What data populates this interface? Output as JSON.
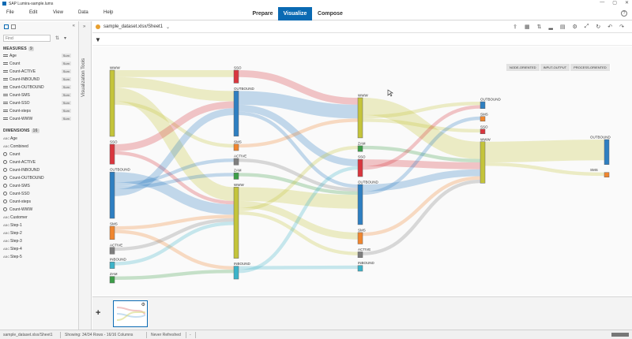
{
  "window": {
    "title": "SAP Lumira-sample.lums",
    "controls": [
      "—",
      "▢",
      "✕"
    ]
  },
  "menubar": {
    "items": [
      "File",
      "Edit",
      "View",
      "Data",
      "Help"
    ],
    "modes": [
      "Prepare",
      "Visualize",
      "Compose"
    ],
    "active_mode": "Visualize"
  },
  "left_panel": {
    "search_placeholder": "Find",
    "measures_label": "MEASURES",
    "measures_count": "9",
    "measures": [
      {
        "name": "Age",
        "agg": "Sum"
      },
      {
        "name": "Count",
        "agg": "Sum"
      },
      {
        "name": "Count-ACTIVE",
        "agg": "Sum"
      },
      {
        "name": "Count-INBOUND",
        "agg": "Sum"
      },
      {
        "name": "Count-OUTBOUND",
        "agg": "Sum"
      },
      {
        "name": "Count-SMS",
        "agg": "Sum"
      },
      {
        "name": "Count-SSO",
        "agg": "Sum"
      },
      {
        "name": "Count-steps",
        "agg": "Sum"
      },
      {
        "name": "Count-WWW",
        "agg": "Sum"
      }
    ],
    "dimensions_label": "DIMENSIONS",
    "dimensions_count": "16",
    "dimensions": [
      {
        "name": "Age",
        "type": "ABC"
      },
      {
        "name": "Combined",
        "type": "ABC"
      },
      {
        "name": "Count",
        "type": "clock"
      },
      {
        "name": "Count-ACTIVE",
        "type": "clock"
      },
      {
        "name": "Count-INBOUND",
        "type": "clock"
      },
      {
        "name": "Count-OUTBOUND",
        "type": "clock"
      },
      {
        "name": "Count-SMS",
        "type": "clock"
      },
      {
        "name": "Count-SSO",
        "type": "clock"
      },
      {
        "name": "Count-steps",
        "type": "clock"
      },
      {
        "name": "Count-WWW",
        "type": "clock"
      },
      {
        "name": "Customer",
        "type": "ABC"
      },
      {
        "name": "Step-1",
        "type": "ABC"
      },
      {
        "name": "Step-2",
        "type": "ABC"
      },
      {
        "name": "Step-3",
        "type": "ABC"
      },
      {
        "name": "Step-4",
        "type": "ABC"
      },
      {
        "name": "Step-5",
        "type": "ABC"
      }
    ]
  },
  "visualization_tools_label": "Visualization Tools",
  "document_tab": {
    "dataset": "sample_dataset.xlsx/Sheet1"
  },
  "view_buttons": [
    "NODE-ORIENTED",
    "INPUT-OUTPUT",
    "PROCESS-ORIENTED"
  ],
  "sankey": {
    "colors": {
      "WWW": "#c4c43a",
      "SSO": "#d9363e",
      "OUTBOUND": "#2e7fc1",
      "SMS": "#f0862e",
      "ACTIVE": "#7f7f7f",
      "INBOUND": "#3cb3c9",
      "ZAM": "#3d9e48"
    },
    "columns": [
      {
        "nodes": [
          {
            "label": "WWW",
            "cat": "WWW"
          },
          {
            "label": "SSO",
            "cat": "SSO"
          },
          {
            "label": "OUTBOUND",
            "cat": "OUTBOUND"
          },
          {
            "label": "SMS",
            "cat": "SMS"
          },
          {
            "label": "ACTIVE",
            "cat": "ACTIVE"
          },
          {
            "label": "INBOUND",
            "cat": "INBOUND"
          },
          {
            "label": "ZAM",
            "cat": "ZAM"
          }
        ]
      },
      {
        "nodes": [
          {
            "label": "SSO",
            "cat": "SSO"
          },
          {
            "label": "OUTBOUND",
            "cat": "OUTBOUND"
          },
          {
            "label": "SMS",
            "cat": "SMS"
          },
          {
            "label": "ACTIVE",
            "cat": "ACTIVE"
          },
          {
            "label": "ZAM",
            "cat": "ZAM"
          },
          {
            "label": "WWW",
            "cat": "WWW"
          },
          {
            "label": "INBOUND",
            "cat": "INBOUND"
          }
        ]
      },
      {
        "nodes": [
          {
            "label": "WWW",
            "cat": "WWW"
          },
          {
            "label": "ZAM",
            "cat": "ZAM"
          },
          {
            "label": "SSO",
            "cat": "SSO"
          },
          {
            "label": "OUTBOUND",
            "cat": "OUTBOUND"
          },
          {
            "label": "SMS",
            "cat": "SMS"
          },
          {
            "label": "ACTIVE",
            "cat": "ACTIVE"
          },
          {
            "label": "INBOUND",
            "cat": "INBOUND"
          }
        ]
      },
      {
        "nodes": [
          {
            "label": "OUTBOUND",
            "cat": "OUTBOUND"
          },
          {
            "label": "SMS",
            "cat": "SMS"
          },
          {
            "label": "SSO",
            "cat": "SSO"
          },
          {
            "label": "WWW",
            "cat": "WWW"
          }
        ]
      },
      {
        "nodes": [
          {
            "label": "OUTBOUND",
            "cat": "OUTBOUND"
          },
          {
            "label": "SMS",
            "cat": "SMS"
          }
        ]
      }
    ],
    "links": [
      {
        "from": [
          0,
          0
        ],
        "to": [
          1,
          0
        ],
        "value": 2
      },
      {
        "from": [
          0,
          0
        ],
        "to": [
          1,
          1
        ],
        "value": 3
      },
      {
        "from": [
          0,
          0
        ],
        "to": [
          1,
          5
        ],
        "value": 4
      },
      {
        "from": [
          0,
          0
        ],
        "to": [
          1,
          2
        ],
        "value": 1
      },
      {
        "from": [
          0,
          1
        ],
        "to": [
          1,
          1
        ],
        "value": 2
      },
      {
        "from": [
          0,
          1
        ],
        "to": [
          1,
          5
        ],
        "value": 1
      },
      {
        "from": [
          0,
          2
        ],
        "to": [
          1,
          5
        ],
        "value": 3
      },
      {
        "from": [
          0,
          2
        ],
        "to": [
          1,
          3
        ],
        "value": 1
      },
      {
        "from": [
          0,
          2
        ],
        "to": [
          1,
          4
        ],
        "value": 1
      },
      {
        "from": [
          0,
          2
        ],
        "to": [
          1,
          1
        ],
        "value": 2
      },
      {
        "from": [
          0,
          3
        ],
        "to": [
          1,
          5
        ],
        "value": 1
      },
      {
        "from": [
          0,
          3
        ],
        "to": [
          1,
          6
        ],
        "value": 1
      },
      {
        "from": [
          0,
          4
        ],
        "to": [
          1,
          5
        ],
        "value": 1
      },
      {
        "from": [
          0,
          5
        ],
        "to": [
          1,
          5
        ],
        "value": 1
      },
      {
        "from": [
          0,
          6
        ],
        "to": [
          1,
          6
        ],
        "value": 1
      },
      {
        "from": [
          1,
          0
        ],
        "to": [
          2,
          0
        ],
        "value": 2
      },
      {
        "from": [
          1,
          1
        ],
        "to": [
          2,
          0
        ],
        "value": 4
      },
      {
        "from": [
          1,
          1
        ],
        "to": [
          2,
          2
        ],
        "value": 2
      },
      {
        "from": [
          1,
          1
        ],
        "to": [
          2,
          3
        ],
        "value": 1
      },
      {
        "from": [
          1,
          2
        ],
        "to": [
          2,
          0
        ],
        "value": 1
      },
      {
        "from": [
          1,
          3
        ],
        "to": [
          2,
          3
        ],
        "value": 1
      },
      {
        "from": [
          1,
          4
        ],
        "to": [
          2,
          3
        ],
        "value": 1
      },
      {
        "from": [
          1,
          5
        ],
        "to": [
          2,
          3
        ],
        "value": 4
      },
      {
        "from": [
          1,
          5
        ],
        "to": [
          2,
          4
        ],
        "value": 2
      },
      {
        "from": [
          1,
          5
        ],
        "to": [
          2,
          1
        ],
        "value": 1
      },
      {
        "from": [
          1,
          5
        ],
        "to": [
          2,
          5
        ],
        "value": 1
      },
      {
        "from": [
          1,
          6
        ],
        "to": [
          2,
          6
        ],
        "value": 1
      },
      {
        "from": [
          1,
          6
        ],
        "to": [
          2,
          2
        ],
        "value": 1
      },
      {
        "from": [
          2,
          0
        ],
        "to": [
          3,
          3
        ],
        "value": 5
      },
      {
        "from": [
          2,
          0
        ],
        "to": [
          3,
          0
        ],
        "value": 1
      },
      {
        "from": [
          2,
          0
        ],
        "to": [
          3,
          2
        ],
        "value": 1
      },
      {
        "from": [
          2,
          1
        ],
        "to": [
          3,
          3
        ],
        "value": 1
      },
      {
        "from": [
          2,
          2
        ],
        "to": [
          3,
          3
        ],
        "value": 2
      },
      {
        "from": [
          2,
          2
        ],
        "to": [
          3,
          0
        ],
        "value": 1
      },
      {
        "from": [
          2,
          3
        ],
        "to": [
          3,
          3
        ],
        "value": 2
      },
      {
        "from": [
          2,
          3
        ],
        "to": [
          3,
          1
        ],
        "value": 1
      },
      {
        "from": [
          2,
          4
        ],
        "to": [
          3,
          3
        ],
        "value": 1
      },
      {
        "from": [
          2,
          5
        ],
        "to": [
          3,
          3
        ],
        "value": 1
      },
      {
        "from": [
          3,
          3
        ],
        "to": [
          4,
          0
        ],
        "value": 6
      },
      {
        "from": [
          3,
          3
        ],
        "to": [
          4,
          1
        ],
        "value": 1
      }
    ]
  },
  "statusbar": {
    "source": "sample_dataset.xlsx/Sheet1",
    "showing": "Showing: 34/34 Rows - 16/16 Columns",
    "refreshed": "Never Refreshed",
    "dash": "-"
  }
}
